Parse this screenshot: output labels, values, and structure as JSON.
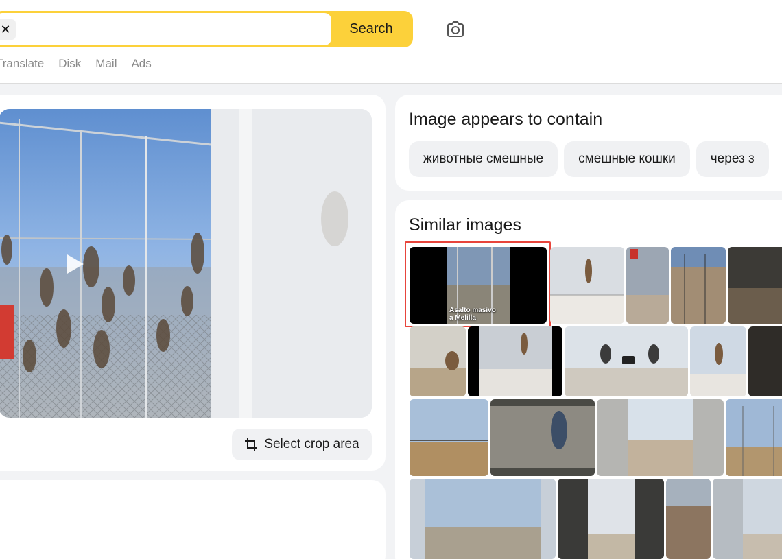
{
  "search": {
    "input_value": "",
    "clear_label": "✕",
    "button_label": "Search",
    "camera_icon": "camera-icon"
  },
  "nav": {
    "items": [
      "Translate",
      "Disk",
      "Mail",
      "Ads"
    ]
  },
  "preview": {
    "play_icon": "play-icon"
  },
  "crop": {
    "label": "Select crop area",
    "icon": "crop-icon"
  },
  "contain": {
    "title": "Image appears to contain",
    "tags": [
      "животные смешные",
      "смешные кошки",
      "через з"
    ]
  },
  "similar": {
    "title": "Similar images",
    "first_caption_line1": "Asalto masivo",
    "first_caption_line2": "a Melilla"
  },
  "colors": {
    "accent": "#fcd13a",
    "highlight": "#e8453c",
    "nav_text": "#8a8a8a"
  }
}
